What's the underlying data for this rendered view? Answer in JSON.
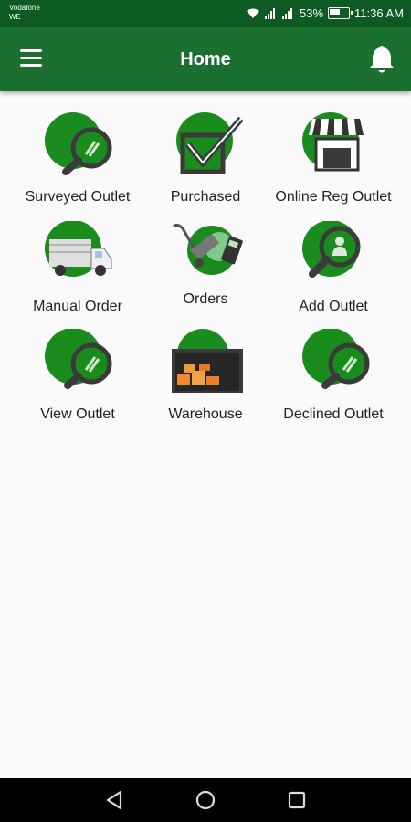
{
  "status": {
    "carrier_line1": "Vodafone",
    "carrier_line2": "WE",
    "battery": "53%",
    "time": "11:36 AM"
  },
  "appbar": {
    "title": "Home",
    "menu_icon": "hamburger-menu-icon",
    "bell_icon": "bell-icon"
  },
  "colors": {
    "primary": "#1b6f31",
    "accent_circle": "#1a8c1e",
    "statusbar": "#0d5b23"
  },
  "tiles": [
    {
      "label": "Surveyed Outlet",
      "icon": "magnifier-icon"
    },
    {
      "label": "Purchased",
      "icon": "checkbox-icon"
    },
    {
      "label": "Online Reg Outlet",
      "icon": "shop-icon"
    },
    {
      "label": "Manual Order",
      "icon": "truck-icon"
    },
    {
      "label": "Orders",
      "icon": "cart-calculator-icon"
    },
    {
      "label": "Add Outlet",
      "icon": "add-person-magnifier-icon"
    },
    {
      "label": "View Outlet",
      "icon": "magnifier-icon"
    },
    {
      "label": "Warehouse",
      "icon": "warehouse-icon"
    },
    {
      "label": "Declined Outlet",
      "icon": "magnifier-icon"
    }
  ]
}
